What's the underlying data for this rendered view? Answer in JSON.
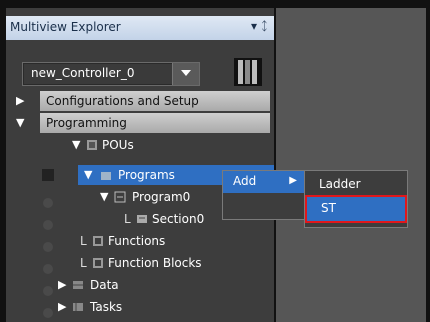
{
  "panel": {
    "title": "Multiview Explorer",
    "pin_glyph": "▾ ᛨ"
  },
  "controller": {
    "selected": "new_Controller_0"
  },
  "tree": {
    "configurations": "Configurations and Setup",
    "programming": "Programming",
    "pous": "POUs",
    "programs": "Programs",
    "program0": "Program0",
    "section0": "Section0",
    "functions": "Functions",
    "function_blocks": "Function Blocks",
    "data": "Data",
    "tasks": "Tasks"
  },
  "context_menu": {
    "add": "Add"
  },
  "submenu": {
    "ladder": "Ladder",
    "st": "ST"
  },
  "colors": {
    "selection": "#2f6fc2",
    "highlight_box": "#e0171c",
    "titlebar": "#c3d3e8"
  }
}
